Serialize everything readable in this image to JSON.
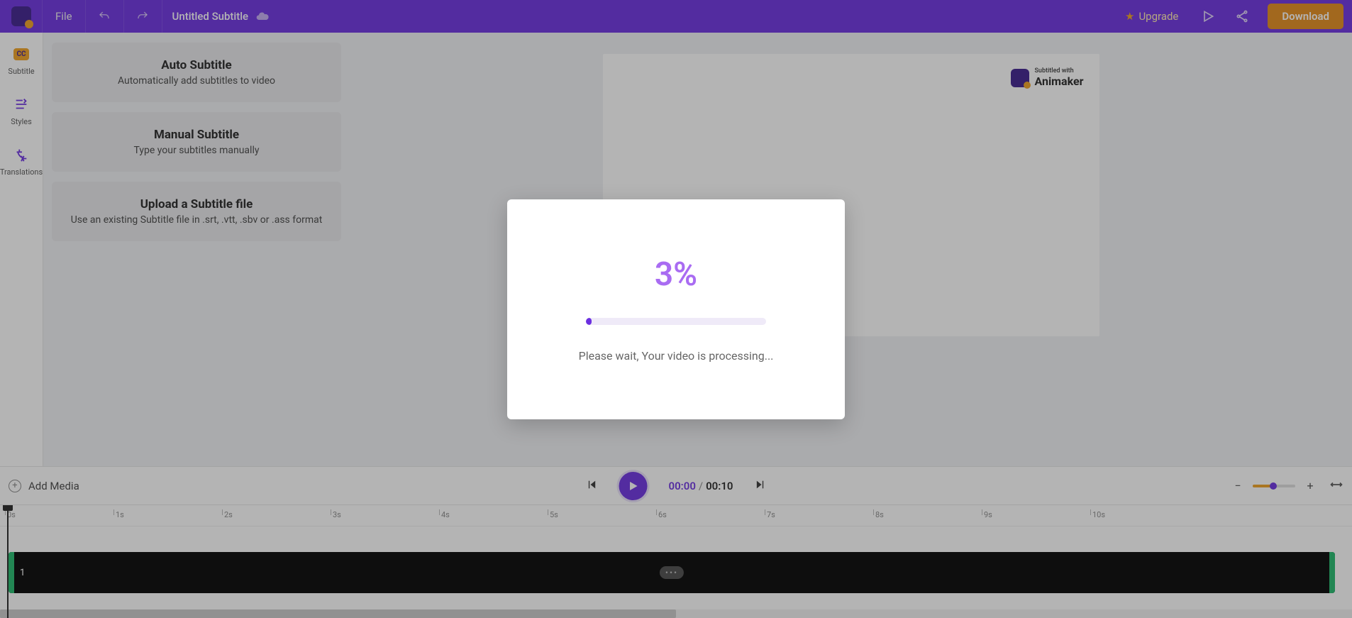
{
  "header": {
    "file_label": "File",
    "project_title": "Untitled Subtitle",
    "upgrade_label": "Upgrade",
    "download_label": "Download"
  },
  "leftbar": {
    "items": [
      {
        "label": "Subtitle",
        "icon": "cc-icon"
      },
      {
        "label": "Styles",
        "icon": "styles-icon"
      },
      {
        "label": "Translations",
        "icon": "translate-icon"
      }
    ]
  },
  "options": [
    {
      "title": "Auto Subtitle",
      "desc": "Automatically add subtitles to video"
    },
    {
      "title": "Manual Subtitle",
      "desc": "Type your subtitles manually"
    },
    {
      "title": "Upload a Subtitle file",
      "desc": "Use an existing Subtitle file in .srt, .vtt, .sbv or .ass format"
    }
  ],
  "watermark": {
    "small": "Subtitled with",
    "brand": "Animaker"
  },
  "playbar": {
    "add_media_label": "Add Media",
    "current_time": "00:00",
    "total_time": "00:10"
  },
  "timeline": {
    "ticks": [
      "0s",
      "1s",
      "2s",
      "3s",
      "4s",
      "5s",
      "6s",
      "7s",
      "8s",
      "9s",
      "10s"
    ],
    "clip_number": "1"
  },
  "modal": {
    "percent": "3%",
    "percent_value": 3,
    "message": "Please wait, Your video is processing..."
  }
}
